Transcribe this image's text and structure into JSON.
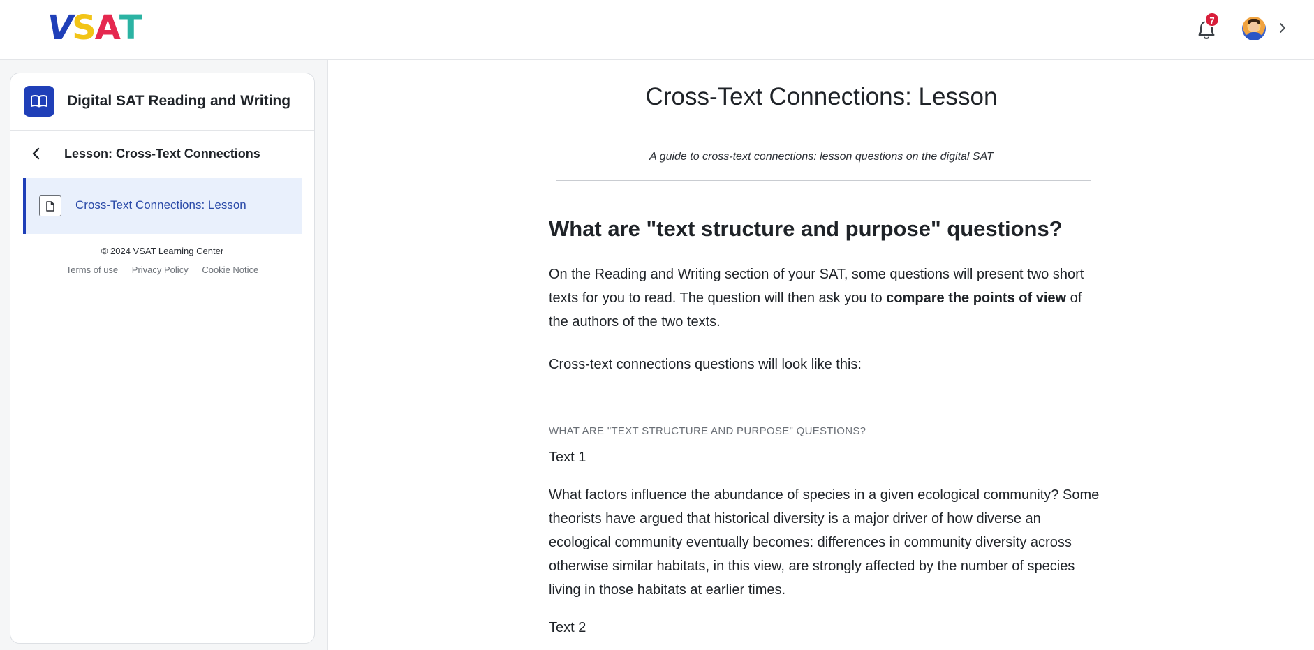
{
  "header": {
    "logo": [
      "V",
      "S",
      "A",
      "T"
    ],
    "notification_count": "7",
    "colors": {
      "brand_blue": "#1f3fb8",
      "brand_yellow": "#f2c417",
      "brand_red": "#e5284f",
      "brand_teal": "#2bb3a3",
      "badge_red": "#d81e3a"
    }
  },
  "sidebar": {
    "course_title": "Digital SAT Reading and Writing",
    "course_icon": "book-icon",
    "lesson_title": "Lesson: Cross-Text Connections",
    "items": [
      {
        "label": "Cross-Text Connections: Lesson",
        "icon": "document-icon",
        "active": true
      }
    ],
    "copyright": "© 2024 VSAT Learning Center",
    "footer_links": [
      "Terms of use",
      "Privacy Policy",
      "Cookie Notice"
    ]
  },
  "main": {
    "title": "Cross-Text Connections: Lesson",
    "subtitle": "A guide to cross-text connections: lesson questions on the digital SAT",
    "heading": "What are \"text structure and purpose\" questions?",
    "para1_start": "On the Reading and Writing section of your SAT, some questions will present two short texts for you to read. The question will then ask you to ",
    "para1_bold": "compare the points of view",
    "para1_end": " of the authors of the two texts.",
    "para2": "Cross-text connections questions will look like this:",
    "eyebrow": "WHAT ARE \"TEXT STRUCTURE AND PURPOSE\" QUESTIONS?",
    "text1_label": "Text 1",
    "text1_body": "What factors influence the abundance of species in a given ecological community? Some theorists have argued that historical diversity is a major driver of how diverse an ecological community eventually becomes: differences in community diversity across otherwise similar habitats, in this view, are strongly affected by the number of species living in those habitats at earlier times.",
    "text2_label": "Text 2"
  }
}
